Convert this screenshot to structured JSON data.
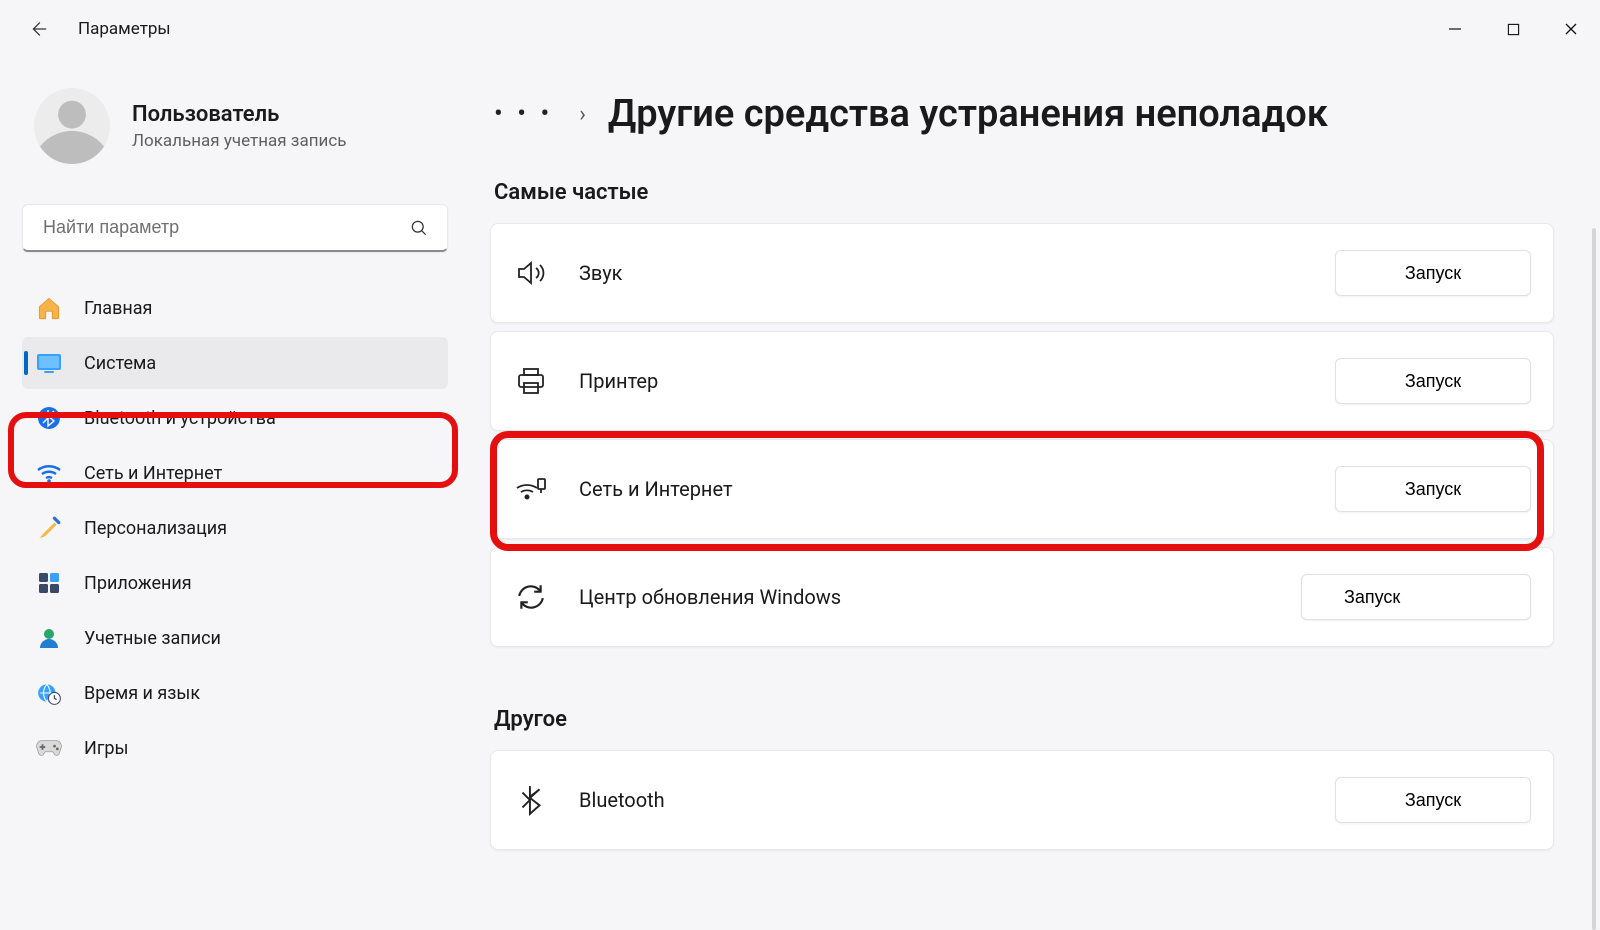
{
  "window": {
    "app_title": "Параметры"
  },
  "user": {
    "name": "Пользователь",
    "subtitle": "Локальная учетная запись"
  },
  "search": {
    "placeholder": "Найти параметр"
  },
  "sidebar": {
    "items": [
      {
        "id": "home",
        "label": "Главная"
      },
      {
        "id": "system",
        "label": "Система",
        "selected": true
      },
      {
        "id": "bluetooth",
        "label": "Bluetooth и устройства"
      },
      {
        "id": "network",
        "label": "Сеть и Интернет"
      },
      {
        "id": "personalize",
        "label": "Персонализация"
      },
      {
        "id": "apps",
        "label": "Приложения"
      },
      {
        "id": "accounts",
        "label": "Учетные записи"
      },
      {
        "id": "time",
        "label": "Время и язык"
      },
      {
        "id": "gaming",
        "label": "Игры"
      }
    ]
  },
  "breadcrumb": {
    "more_label": "• • •",
    "separator": "›",
    "title": "Другие средства устранения неполадок"
  },
  "sections": {
    "frequent": "Самые частые",
    "other": "Другое"
  },
  "troubleshooters": {
    "frequent": [
      {
        "id": "audio",
        "label": "Звук",
        "button": "Запуск"
      },
      {
        "id": "printer",
        "label": "Принтер",
        "button": "Запуск"
      },
      {
        "id": "network",
        "label": "Сеть и Интернет",
        "button": "Запуск"
      },
      {
        "id": "update",
        "label": "Центр обновления Windows",
        "button": "Запуск"
      }
    ],
    "other": [
      {
        "id": "bluetooth",
        "label": "Bluetooth",
        "button": "Запуск"
      }
    ]
  },
  "annotations": {
    "highlighted_sidebar_item": "system",
    "highlighted_troubleshooter": "network",
    "hovered_troubleshooter": "update"
  }
}
